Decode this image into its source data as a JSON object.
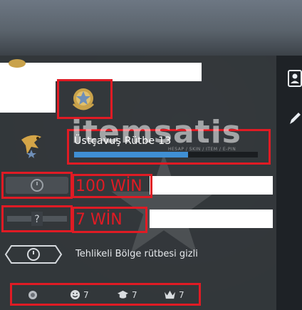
{
  "profile": {
    "rank_name": "Üstçavuş Rütbe 13",
    "rank_progress": 0.62,
    "wins_competitive": "100 WİN",
    "wins_wingman": "7 WİN",
    "danger_zone_text": "Tehlikeli Bölge rütbesi gizli"
  },
  "stats": [
    {
      "icon": "smiley-icon",
      "value": "7"
    },
    {
      "icon": "graduation-cap-icon",
      "value": "7"
    },
    {
      "icon": "crown-icon",
      "value": "7"
    }
  ],
  "watermark": {
    "brand": "itemsatis",
    "sub": "HESAP / SKIN / ITEM / E-PIN"
  },
  "colors": {
    "annotation_red": "#e01b24",
    "progress_blue": "#3f8fd4",
    "panel_bg": "#34383c"
  }
}
